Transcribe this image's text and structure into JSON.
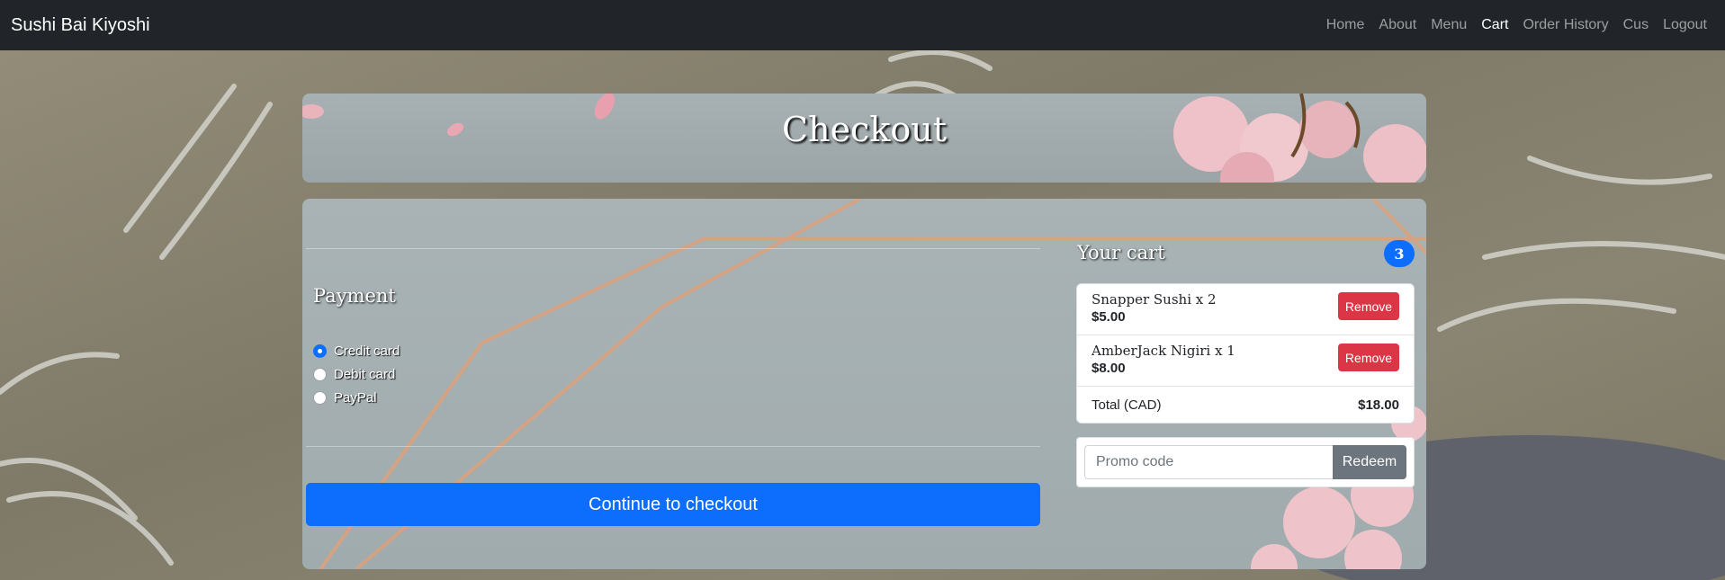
{
  "navbar": {
    "brand": "Sushi Bai Kiyoshi",
    "links": [
      "Home",
      "About",
      "Menu",
      "Cart",
      "Order History",
      "Cus",
      "Logout"
    ],
    "active": "Cart"
  },
  "header": {
    "title": "Checkout"
  },
  "payment": {
    "title": "Payment",
    "methods": [
      {
        "label": "Credit card",
        "checked": true
      },
      {
        "label": "Debit card",
        "checked": false
      },
      {
        "label": "PayPal",
        "checked": false
      }
    ],
    "checkout_label": "Continue to checkout"
  },
  "cart": {
    "title": "Your cart",
    "count": "3",
    "items": [
      {
        "name": "Snapper Sushi x 2",
        "price": "$5.00",
        "remove_label": "Remove"
      },
      {
        "name": "AmberJack Nigiri x 1",
        "price": "$8.00",
        "remove_label": "Remove"
      }
    ],
    "total_label": "Total (CAD)",
    "total_value": "$18.00"
  },
  "promo": {
    "placeholder": "Promo code",
    "button_label": "Redeem"
  },
  "colors": {
    "navbar": "#212529",
    "primary": "#0d6efd",
    "danger": "#dc3545",
    "secondary": "#6c757d"
  }
}
